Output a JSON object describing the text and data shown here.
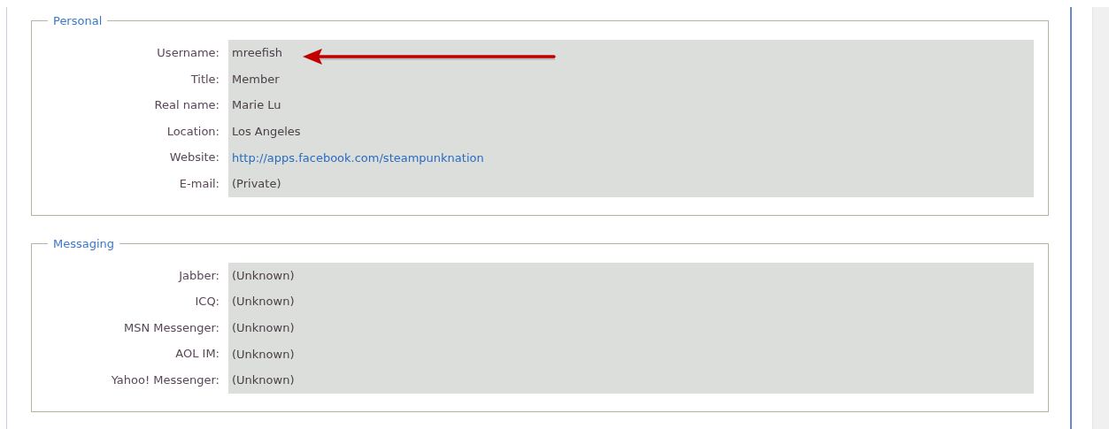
{
  "sections": [
    {
      "legend": "Personal",
      "annotated": true,
      "fields": [
        {
          "label": "Username:",
          "value": "mreefish",
          "kind": "text"
        },
        {
          "label": "Title:",
          "value": "Member",
          "kind": "text"
        },
        {
          "label": "Real name:",
          "value": "Marie Lu",
          "kind": "text"
        },
        {
          "label": "Location:",
          "value": "Los Angeles",
          "kind": "text"
        },
        {
          "label": "Website:",
          "value": "http://apps.facebook.com/steampunknation",
          "kind": "link"
        },
        {
          "label": "E-mail:",
          "value": "(Private)",
          "kind": "text"
        }
      ]
    },
    {
      "legend": "Messaging",
      "annotated": false,
      "fields": [
        {
          "label": "Jabber:",
          "value": "(Unknown)",
          "kind": "text"
        },
        {
          "label": "ICQ:",
          "value": "(Unknown)",
          "kind": "text"
        },
        {
          "label": "MSN Messenger:",
          "value": "(Unknown)",
          "kind": "text"
        },
        {
          "label": "AOL IM:",
          "value": "(Unknown)",
          "kind": "text"
        },
        {
          "label": "Yahoo! Messenger:",
          "value": "(Unknown)",
          "kind": "text"
        }
      ]
    }
  ]
}
